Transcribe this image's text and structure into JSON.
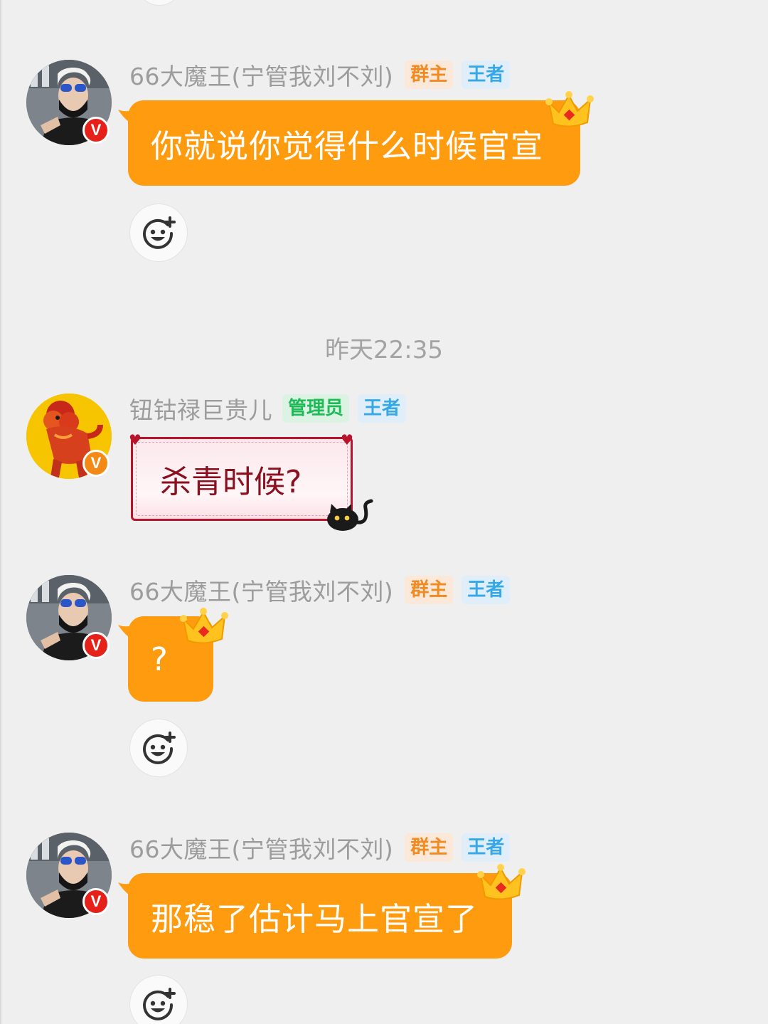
{
  "timestamp": "昨天22:35",
  "messages": [
    {
      "sender": "66大魔王(宁管我刘不刘)",
      "role_tag": "群主",
      "rank_tag": "王者",
      "text": "你就说你觉得什么时候官宣",
      "bubble_style": "orange-crown",
      "badge": "V"
    },
    {
      "sender": "钮钴禄巨贵儿",
      "role_tag": "管理员",
      "rank_tag": "王者",
      "text": "杀青时候?",
      "bubble_style": "pink-frame-cat",
      "badge": "V"
    },
    {
      "sender": "66大魔王(宁管我刘不刘)",
      "role_tag": "群主",
      "rank_tag": "王者",
      "text": "?",
      "bubble_style": "orange-crown",
      "badge": "V"
    },
    {
      "sender": "66大魔王(宁管我刘不刘)",
      "role_tag": "群主",
      "rank_tag": "王者",
      "text": "那稳了估计马上官宣了",
      "bubble_style": "orange-crown",
      "badge": "V"
    }
  ],
  "icons": {
    "reaction": "add-emoji-reaction-icon",
    "crown": "crown-icon",
    "cat": "black-cat-sticker-icon",
    "heart": "heart-icon"
  },
  "colors": {
    "background": "#efefef",
    "orange_bubble": "#ff9b0e",
    "owner_tag": "#f28a22",
    "admin_tag": "#1dbb55",
    "king_tag": "#36a8e5",
    "pink_bubble_border": "#b8142c",
    "pink_bubble_text": "#8a1020"
  }
}
